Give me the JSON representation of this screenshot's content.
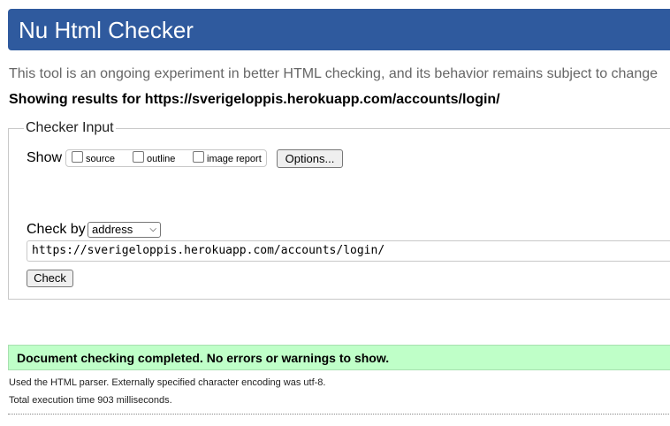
{
  "header": {
    "title": "Nu Html Checker"
  },
  "intro": "This tool is an ongoing experiment in better HTML checking, and its behavior remains subject to change",
  "showing_results": "Showing results for https://sverigeloppis.herokuapp.com/accounts/login/",
  "checker_input": {
    "legend": "Checker Input",
    "show_label": "Show",
    "options": [
      {
        "label": "source",
        "checked": false
      },
      {
        "label": "outline",
        "checked": false
      },
      {
        "label": "image report",
        "checked": false
      }
    ],
    "options_button": "Options...",
    "check_by_label": "Check by",
    "check_by_value": "address",
    "url_value": "https://sverigeloppis.herokuapp.com/accounts/login/",
    "check_button": "Check"
  },
  "results": {
    "success_message": "Document checking completed. No errors or warnings to show.",
    "parser_info": "Used the HTML parser. Externally specified character encoding was utf-8.",
    "execution_time": "Total execution time 903 milliseconds."
  },
  "colors": {
    "header_bg": "#2f5a9e",
    "success_bg": "#bfffc8"
  }
}
